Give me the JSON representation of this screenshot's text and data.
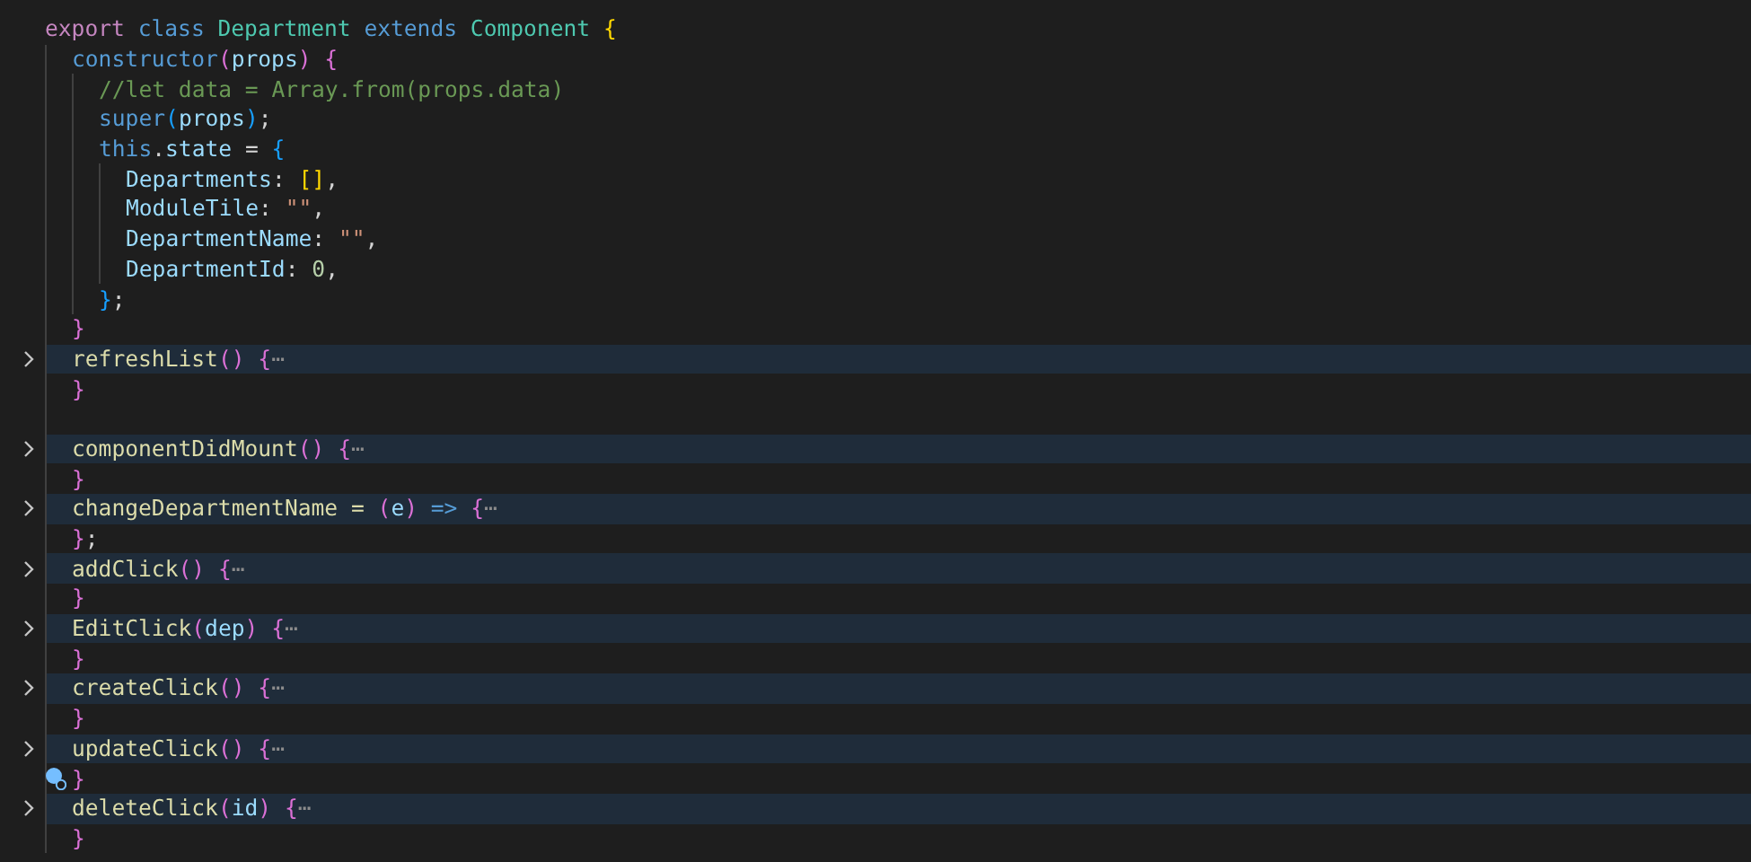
{
  "editor": {
    "lines": [
      {
        "folded": false,
        "tokens": [
          {
            "t": "export ",
            "color": "#c586c0"
          },
          {
            "t": "class ",
            "color": "#569cd6"
          },
          {
            "t": "Department ",
            "color": "#4ec9b0"
          },
          {
            "t": "extends ",
            "color": "#569cd6"
          },
          {
            "t": "Component ",
            "color": "#4ec9b0"
          },
          {
            "t": "{",
            "color": "#ffd700"
          }
        ],
        "children": [
          {
            "folded": false,
            "tokens": [
              {
                "t": "constructor",
                "color": "#569cd6"
              },
              {
                "t": "(",
                "color": "#da70d6"
              },
              {
                "t": "props",
                "color": "#9cdcfe"
              },
              {
                "t": ") {",
                "color": "#da70d6"
              }
            ],
            "children": [
              {
                "folded": false,
                "tokens": [
                  {
                    "t": "//let data = Array.from(props.data)",
                    "color": "#6a9955"
                  }
                ]
              },
              {
                "folded": false,
                "tokens": [
                  {
                    "t": "super",
                    "color": "#569cd6"
                  },
                  {
                    "t": "(",
                    "color": "#179fff"
                  },
                  {
                    "t": "props",
                    "color": "#9cdcfe"
                  },
                  {
                    "t": ")",
                    "color": "#179fff"
                  },
                  {
                    "t": ";",
                    "color": "#d4d4d4"
                  }
                ]
              },
              {
                "folded": false,
                "tokens": [
                  {
                    "t": "this",
                    "color": "#569cd6"
                  },
                  {
                    "t": ".",
                    "color": "#d4d4d4"
                  },
                  {
                    "t": "state",
                    "color": "#9cdcfe"
                  },
                  {
                    "t": " = ",
                    "color": "#d4d4d4"
                  },
                  {
                    "t": "{",
                    "color": "#179fff"
                  }
                ],
                "children": [
                  {
                    "folded": false,
                    "tokens": [
                      {
                        "t": "Departments",
                        "color": "#9cdcfe"
                      },
                      {
                        "t": ": ",
                        "color": "#d4d4d4"
                      },
                      {
                        "t": "[]",
                        "color": "#ffd700"
                      },
                      {
                        "t": ",",
                        "color": "#d4d4d4"
                      }
                    ]
                  },
                  {
                    "folded": false,
                    "tokens": [
                      {
                        "t": "ModuleTile",
                        "color": "#9cdcfe"
                      },
                      {
                        "t": ": ",
                        "color": "#d4d4d4"
                      },
                      {
                        "t": "\"\"",
                        "color": "#ce9178"
                      },
                      {
                        "t": ",",
                        "color": "#d4d4d4"
                      }
                    ]
                  },
                  {
                    "folded": false,
                    "tokens": [
                      {
                        "t": "DepartmentName",
                        "color": "#9cdcfe"
                      },
                      {
                        "t": ": ",
                        "color": "#d4d4d4"
                      },
                      {
                        "t": "\"\"",
                        "color": "#ce9178"
                      },
                      {
                        "t": ",",
                        "color": "#d4d4d4"
                      }
                    ]
                  },
                  {
                    "folded": false,
                    "tokens": [
                      {
                        "t": "DepartmentId",
                        "color": "#9cdcfe"
                      },
                      {
                        "t": ": ",
                        "color": "#d4d4d4"
                      },
                      {
                        "t": "0",
                        "color": "#b5cea8"
                      },
                      {
                        "t": ",",
                        "color": "#d4d4d4"
                      }
                    ]
                  }
                ]
              },
              {
                "folded": false,
                "tokens": [
                  {
                    "t": "}",
                    "color": "#179fff"
                  },
                  {
                    "t": ";",
                    "color": "#d4d4d4"
                  }
                ]
              }
            ]
          },
          {
            "folded": false,
            "tokens": [
              {
                "t": "}",
                "color": "#da70d6"
              }
            ]
          },
          {
            "folded": true,
            "tokens": [
              {
                "t": "refreshList",
                "color": "#dcdcaa"
              },
              {
                "t": "() {",
                "color": "#da70d6"
              },
              {
                "t": "⋯",
                "color": "#8c8c8c"
              }
            ]
          },
          {
            "folded": false,
            "tokens": [
              {
                "t": "}",
                "color": "#da70d6"
              }
            ]
          },
          {
            "folded": false
          },
          {
            "folded": true,
            "tokens": [
              {
                "t": "componentDidMount",
                "color": "#dcdcaa"
              },
              {
                "t": "() {",
                "color": "#da70d6"
              },
              {
                "t": "⋯",
                "color": "#8c8c8c"
              }
            ]
          },
          {
            "folded": false,
            "tokens": [
              {
                "t": "}",
                "color": "#da70d6"
              }
            ]
          },
          {
            "folded": true,
            "tokens": [
              {
                "t": "changeDepartmentName = ",
                "color": "#dcdcaa"
              },
              {
                "t": "(",
                "color": "#da70d6"
              },
              {
                "t": "e",
                "color": "#9cdcfe"
              },
              {
                "t": ") ",
                "color": "#da70d6"
              },
              {
                "t": "=> ",
                "color": "#569cd6"
              },
              {
                "t": "{",
                "color": "#da70d6"
              },
              {
                "t": "⋯",
                "color": "#8c8c8c"
              }
            ]
          },
          {
            "folded": false,
            "tokens": [
              {
                "t": "}",
                "color": "#da70d6"
              },
              {
                "t": ";",
                "color": "#d4d4d4"
              }
            ]
          },
          {
            "folded": true,
            "tokens": [
              {
                "t": "addClick",
                "color": "#dcdcaa"
              },
              {
                "t": "() {",
                "color": "#da70d6"
              },
              {
                "t": "⋯",
                "color": "#8c8c8c"
              }
            ]
          },
          {
            "folded": false,
            "tokens": [
              {
                "t": "}",
                "color": "#da70d6"
              }
            ]
          },
          {
            "folded": true,
            "tokens": [
              {
                "t": "EditClick",
                "color": "#dcdcaa"
              },
              {
                "t": "(",
                "color": "#da70d6"
              },
              {
                "t": "dep",
                "color": "#9cdcfe"
              },
              {
                "t": ") {",
                "color": "#da70d6"
              },
              {
                "t": "⋯",
                "color": "#8c8c8c"
              }
            ]
          },
          {
            "folded": false,
            "tokens": [
              {
                "t": "}",
                "color": "#da70d6"
              }
            ]
          },
          {
            "folded": true,
            "tokens": [
              {
                "t": "createClick",
                "color": "#dcdcaa"
              },
              {
                "t": "() {",
                "color": "#da70d6"
              },
              {
                "t": "⋯",
                "color": "#8c8c8c"
              }
            ]
          },
          {
            "folded": false,
            "tokens": [
              {
                "t": "}",
                "color": "#da70d6"
              }
            ]
          },
          {
            "folded": true,
            "tokens": [
              {
                "t": "updateClick",
                "color": "#dcdcaa"
              },
              {
                "t": "() {",
                "color": "#da70d6"
              },
              {
                "t": "⋯",
                "color": "#8c8c8c"
              }
            ]
          },
          {
            "folded": false,
            "lightbulb": true,
            "tokens": [
              {
                "t": "}",
                "color": "#da70d6"
              }
            ]
          },
          {
            "folded": true,
            "tokens": [
              {
                "t": "deleteClick",
                "color": "#dcdcaa"
              },
              {
                "t": "(",
                "color": "#da70d6"
              },
              {
                "t": "id",
                "color": "#9cdcfe"
              },
              {
                "t": ") {",
                "color": "#da70d6"
              },
              {
                "t": "⋯",
                "color": "#8c8c8c"
              }
            ]
          },
          {
            "folded": false,
            "tokens": [
              {
                "t": "}",
                "color": "#da70d6"
              }
            ]
          }
        ]
      }
    ]
  }
}
